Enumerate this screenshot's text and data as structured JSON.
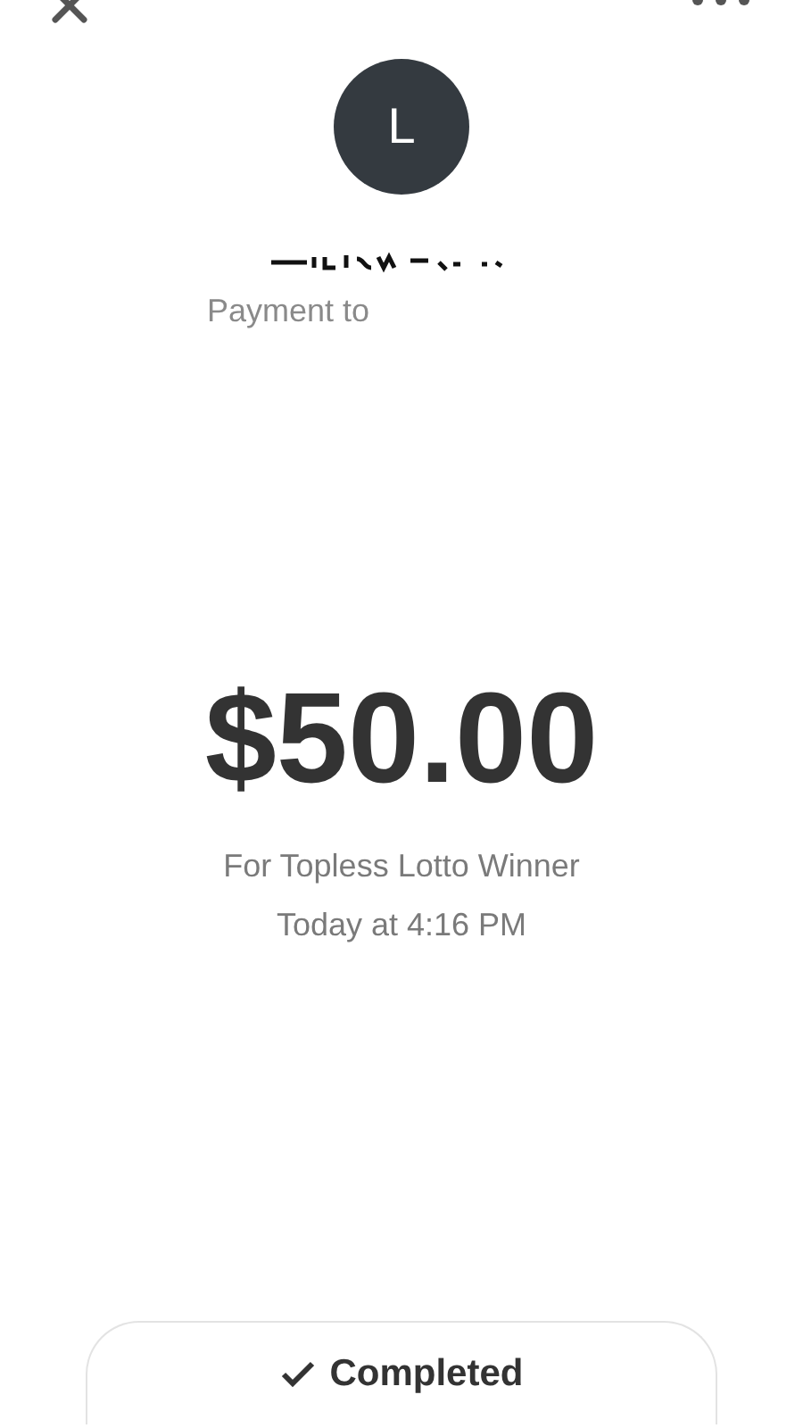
{
  "avatar": {
    "initial": "L"
  },
  "payment": {
    "label": "Payment to",
    "amount": "$50.00",
    "note": "For Topless Lotto Winner",
    "time": "Today at 4:16 PM"
  },
  "status": {
    "label": "Completed"
  }
}
